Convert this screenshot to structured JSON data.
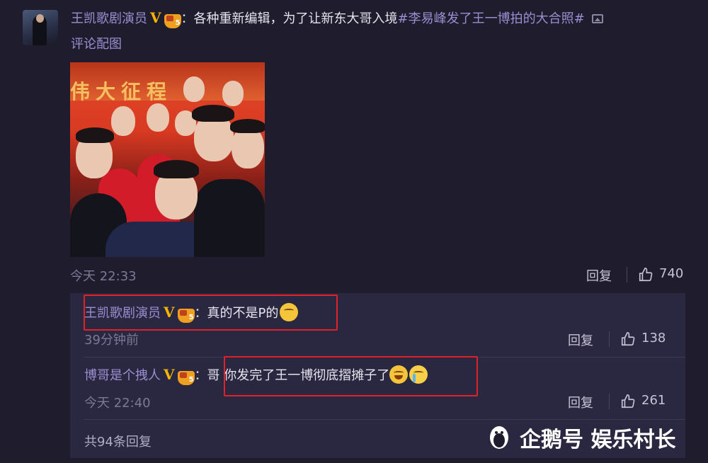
{
  "post": {
    "username": "王凯歌剧演员",
    "verified_mark": "V",
    "level_badge": "5",
    "colon": "：",
    "text": "各种重新编辑，为了让新东大哥入境",
    "hashtag": "#李易峰发了王一博拍的大合照#",
    "image_link": "评论配图",
    "photo_banner": "伟大征程",
    "time": "今天 22:33",
    "reply_label": "回复",
    "like_count": "740"
  },
  "replies": [
    {
      "username": "王凯歌剧演员",
      "verified_mark": "V",
      "level_badge": "5",
      "colon": "：",
      "text": "真的不是P的",
      "time": "39分钟前",
      "reply_label": "回复",
      "like_count": "138"
    },
    {
      "username": "博哥是个拽人",
      "verified_mark": "V",
      "level_badge": "5",
      "colon": "：",
      "text": "哥 你发完了王一博彻底摺摊子了",
      "time": "今天 22:40",
      "reply_label": "回复",
      "like_count": "261"
    }
  ],
  "total_replies": "共94条回复",
  "watermark": "企鹅号 娱乐村长",
  "colors": {
    "background": "#1f1c2e",
    "reply_box": "#2a2740",
    "username": "#9a8fd0",
    "highlight_box": "#e0202a",
    "verified": "#f5b400"
  },
  "icons": [
    "image-icon",
    "thumbs-up-icon",
    "penguin-logo-icon",
    "emoji-icon"
  ]
}
